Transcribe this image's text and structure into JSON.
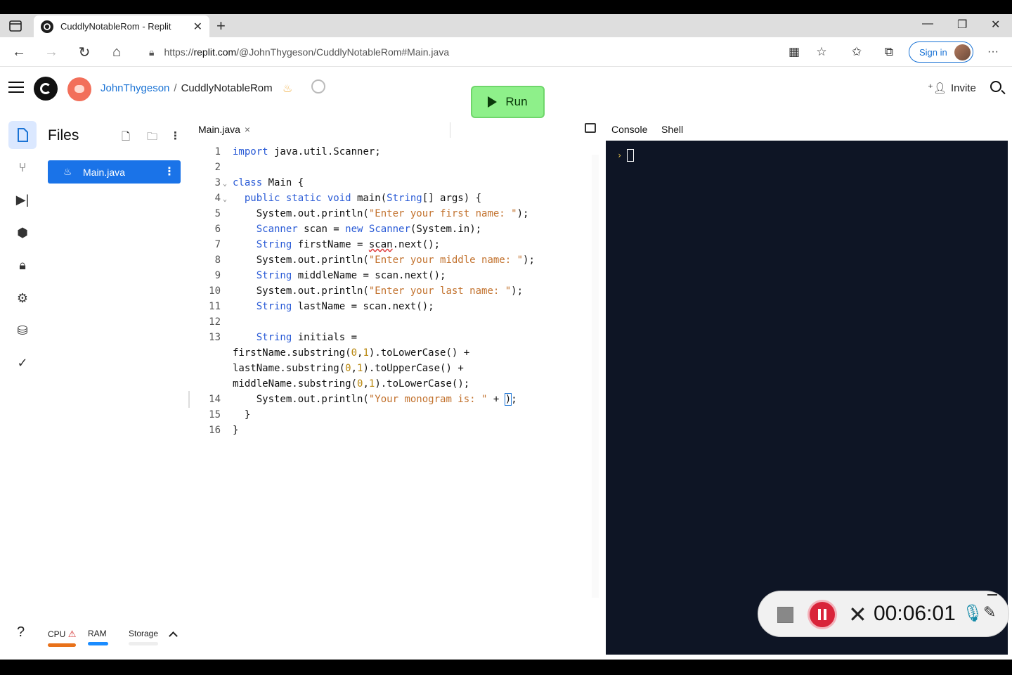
{
  "browser": {
    "tab_title": "CuddlyNotableRom - Replit",
    "url_prefix": "https://",
    "url_host": "replit.com",
    "url_path": "/@JohnThygeson/CuddlyNotableRom#Main.java",
    "sign_in_label": "Sign in"
  },
  "header": {
    "username": "JohnThygeson",
    "separator": "/",
    "repl_name": "CuddlyNotableRom",
    "run_label": "Run",
    "invite_label": "Invite"
  },
  "files": {
    "title": "Files",
    "items": [
      {
        "name": "Main.java"
      }
    ]
  },
  "editor": {
    "tab_label": "Main.java",
    "lines": [
      {
        "num": "1"
      },
      {
        "num": "2"
      },
      {
        "num": "3"
      },
      {
        "num": "4"
      },
      {
        "num": "5"
      },
      {
        "num": "6"
      },
      {
        "num": "7"
      },
      {
        "num": "8"
      },
      {
        "num": "9"
      },
      {
        "num": "10"
      },
      {
        "num": "11"
      },
      {
        "num": "12"
      },
      {
        "num": "13"
      },
      {
        "num": "14"
      },
      {
        "num": "15"
      },
      {
        "num": "16"
      }
    ]
  },
  "console": {
    "tabs": [
      "Console",
      "Shell"
    ],
    "prompt": "›"
  },
  "recorder": {
    "elapsed": "00:06:01"
  },
  "status": {
    "help": "?",
    "cpu_label": "CPU",
    "ram_label": "RAM",
    "storage_label": "Storage",
    "cpu_color": "#e8711a",
    "ram_color": "#1a8cff"
  }
}
